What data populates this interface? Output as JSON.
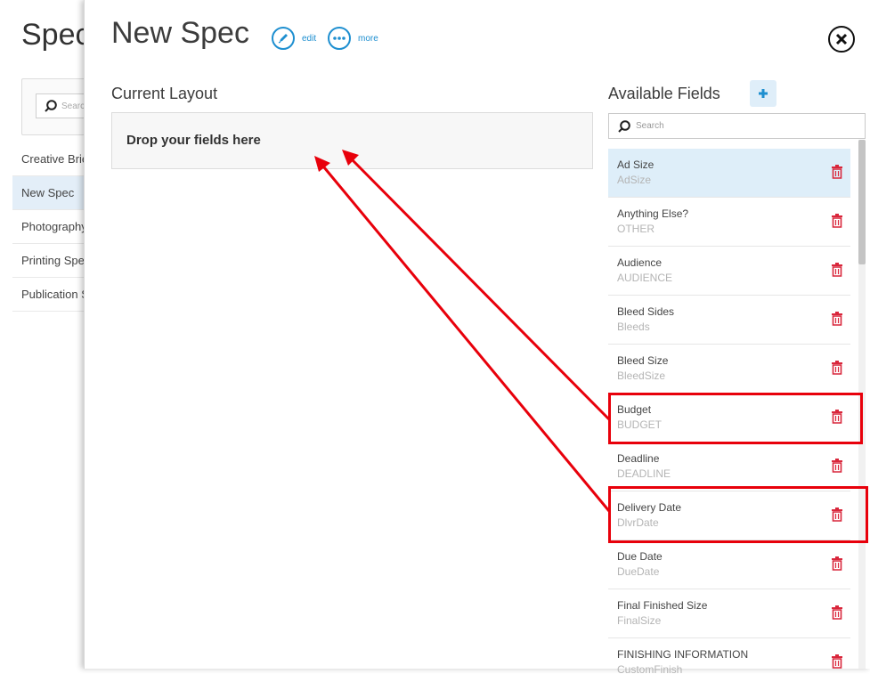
{
  "background_page": {
    "title": "Spec",
    "search_placeholder": "Search",
    "items": [
      {
        "label": "Creative Brief"
      },
      {
        "label": "New Spec"
      },
      {
        "label": "Photography"
      },
      {
        "label": "Printing Spec"
      },
      {
        "label": "Publication Spec"
      }
    ],
    "selected_item": "New Spec"
  },
  "modal": {
    "title": "New Spec",
    "edit_label": "edit",
    "more_label": "more"
  },
  "current_layout": {
    "title": "Current Layout",
    "drop_text": "Drop your fields here"
  },
  "available_fields": {
    "title": "Available Fields",
    "search_placeholder": "Search",
    "selected_field": "Ad Size",
    "fields": [
      {
        "label": "Ad Size",
        "code": "AdSize"
      },
      {
        "label": "Anything Else?",
        "code": "OTHER"
      },
      {
        "label": "Audience",
        "code": "AUDIENCE"
      },
      {
        "label": "Bleed Sides",
        "code": "Bleeds"
      },
      {
        "label": "Bleed Size",
        "code": "BleedSize"
      },
      {
        "label": "Budget",
        "code": "BUDGET"
      },
      {
        "label": "Deadline",
        "code": "DEADLINE"
      },
      {
        "label": "Delivery Date",
        "code": "DlvrDate"
      },
      {
        "label": "Due Date",
        "code": "DueDate"
      },
      {
        "label": "Final Finished Size",
        "code": "FinalSize"
      },
      {
        "label": "FINISHING INFORMATION",
        "code": "CustomFinish"
      }
    ]
  },
  "annotations": {
    "highlighted_fields": [
      "Budget",
      "Delivery Date"
    ],
    "color": "#e8000b"
  },
  "colors": {
    "accent": "#1e8fd0",
    "selected_bg": "#deeef9",
    "trash": "#d9263b",
    "annotation": "#e8000b"
  }
}
